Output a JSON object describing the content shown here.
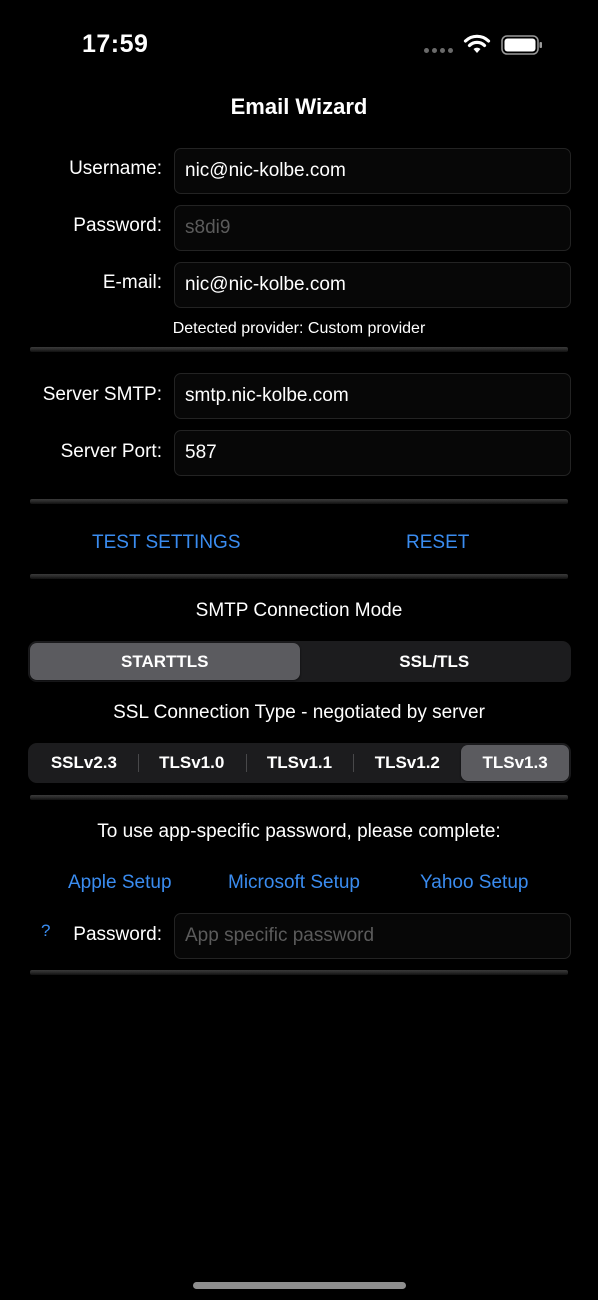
{
  "status_bar": {
    "time": "17:59",
    "icons": [
      "cellular-signal-icon",
      "wifi-icon",
      "battery-icon"
    ]
  },
  "title": "Email Wizard",
  "account": {
    "username_label": "Username:",
    "username_value": "nic@nic-kolbe.com",
    "password_label": "Password:",
    "password_placeholder": "s8di9",
    "email_label": "E-mail:",
    "email_value": "nic@nic-kolbe.com",
    "detected_provider": "Detected provider: Custom provider"
  },
  "server": {
    "smtp_label": "Server SMTP:",
    "smtp_value": "smtp.nic-kolbe.com",
    "port_label": "Server Port:",
    "port_value": "587"
  },
  "actions": {
    "test_label": "TEST SETTINGS",
    "reset_label": "RESET"
  },
  "connection_mode": {
    "heading": "SMTP Connection Mode",
    "options": [
      "STARTTLS",
      "SSL/TLS"
    ],
    "selected": "STARTTLS"
  },
  "ssl_type": {
    "heading": "SSL Connection Type - negotiated by server",
    "options": [
      "SSLv2.3",
      "TLSv1.0",
      "TLSv1.1",
      "TLSv1.2",
      "TLSv1.3"
    ],
    "selected": "TLSv1.3"
  },
  "app_password": {
    "instruction": "To use app-specific password, please complete:",
    "links": [
      "Apple Setup",
      "Microsoft Setup",
      "Yahoo Setup"
    ],
    "help_symbol": "?",
    "label": "Password:",
    "placeholder": "App specific password"
  },
  "colors": {
    "background": "#000000",
    "link": "#3a8cf0",
    "segment_selected": "#5b5b5f"
  }
}
